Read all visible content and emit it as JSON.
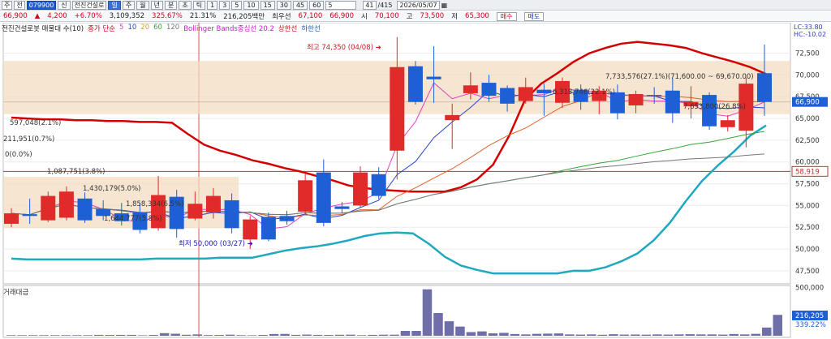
{
  "toolbar": {
    "market": "주",
    "side": "전",
    "code": "079900",
    "name_tag": "신",
    "stock_name": "전진건설로",
    "periods": [
      "일",
      "주",
      "월",
      "년",
      "분",
      "초",
      "틱"
    ],
    "selected_period": "일",
    "intervals": [
      "1",
      "3",
      "5",
      "10",
      "15",
      "30",
      "45",
      "60"
    ],
    "interval_value": "5",
    "page": "41",
    "total": "/415",
    "date": "2026/05/07",
    "calendar_icon": "calendar-icon"
  },
  "quote": {
    "price": "66,900",
    "arrow": "▲",
    "change": "4,200",
    "pct": "+6.70%",
    "volume": "3,109,352",
    "vol_ratio": "325.67%",
    "turnover": "21.31%",
    "amount": "216,205백만",
    "best_label": "최우선",
    "best": "67,100",
    "best2": "66,900",
    "open_label": "시",
    "open": "70,100",
    "high_label": "고",
    "high": "73,500",
    "low_label": "저",
    "low": "65,300",
    "buy_label": "매수",
    "sell_label": "매도"
  },
  "legend": {
    "title": "전진건설로봇 매물대 수(10)",
    "ma_label": "종가 단순",
    "ma_periods": [
      "5",
      "10",
      "20",
      "60",
      "120"
    ],
    "bb_label": "Bollinger Bands중심선 20.2",
    "upper_label": "상한선",
    "lower_label": "하한선"
  },
  "colors": {
    "up": "#e12a2a",
    "down": "#1f5fd6",
    "bb_mid": "#d40000",
    "bb_lower": "#1fa8bf",
    "ma5": "#e040c0",
    "ma10": "#2a44c8",
    "ma20": "#e0602a",
    "ma60": "#3aa33a",
    "ma120": "#777777",
    "volume": "#6e6ea8",
    "profile": "#f3dcc0"
  },
  "annotations": {
    "high_note": "최고 74,350 (04/08)",
    "low_note": "최저 50,000 (03/27)",
    "lc": "LC:33.80",
    "hc": "HC:-10.02"
  },
  "chart_data": {
    "type": "candlestick",
    "ylim": [
      46000,
      76000
    ],
    "yticks": [
      "72,500",
      "70,000",
      "67,500",
      "65,000",
      "62,500",
      "60,000",
      "57,500",
      "55,000",
      "52,500",
      "50,000",
      "47,500"
    ],
    "ytick_values": [
      72500,
      70000,
      67500,
      65000,
      62500,
      60000,
      57500,
      55000,
      52500,
      50000,
      47500
    ],
    "price_marker": "66,900",
    "price_marker_value": 66900,
    "line_marker": "58,919",
    "line_marker_value": 58919,
    "candles": [
      {
        "o": 52900,
        "c": 54100,
        "h": 54700,
        "l": 52500
      },
      {
        "o": 54000,
        "c": 53800,
        "h": 55800,
        "l": 52900
      },
      {
        "o": 53300,
        "c": 56100,
        "h": 56600,
        "l": 53100
      },
      {
        "o": 53600,
        "c": 56600,
        "h": 57200,
        "l": 53300
      },
      {
        "o": 55800,
        "c": 53300,
        "h": 56500,
        "l": 53000
      },
      {
        "o": 54600,
        "c": 53800,
        "h": 55600,
        "l": 53300
      },
      {
        "o": 54100,
        "c": 53200,
        "h": 55300,
        "l": 52700
      },
      {
        "o": 54200,
        "c": 52200,
        "h": 55300,
        "l": 51800
      },
      {
        "o": 52400,
        "c": 56200,
        "h": 58400,
        "l": 52100
      },
      {
        "o": 56000,
        "c": 52300,
        "h": 56800,
        "l": 51300
      },
      {
        "o": 53500,
        "c": 55200,
        "h": 56600,
        "l": 53300
      },
      {
        "o": 54200,
        "c": 56100,
        "h": 57000,
        "l": 53500
      },
      {
        "o": 55600,
        "c": 52400,
        "h": 56400,
        "l": 51800
      },
      {
        "o": 51100,
        "c": 53400,
        "h": 53800,
        "l": 50000
      },
      {
        "o": 53700,
        "c": 51100,
        "h": 54200,
        "l": 50900
      },
      {
        "o": 53800,
        "c": 53200,
        "h": 54400,
        "l": 52800
      },
      {
        "o": 54300,
        "c": 57900,
        "h": 58600,
        "l": 54100
      },
      {
        "o": 58800,
        "c": 53000,
        "h": 60300,
        "l": 52600
      },
      {
        "o": 54900,
        "c": 54600,
        "h": 55400,
        "l": 54100
      },
      {
        "o": 55000,
        "c": 58800,
        "h": 59500,
        "l": 54800
      },
      {
        "o": 58600,
        "c": 56100,
        "h": 59400,
        "l": 55700
      },
      {
        "o": 61300,
        "c": 70900,
        "h": 74350,
        "l": 58000
      },
      {
        "o": 71000,
        "c": 66900,
        "h": 71600,
        "l": 66600
      },
      {
        "o": 69800,
        "c": 69500,
        "h": 73300,
        "l": 66800
      },
      {
        "o": 64800,
        "c": 65400,
        "h": 66700,
        "l": 61500
      },
      {
        "o": 67900,
        "c": 68800,
        "h": 70300,
        "l": 67200
      },
      {
        "o": 69100,
        "c": 67600,
        "h": 70000,
        "l": 66900
      },
      {
        "o": 68500,
        "c": 66700,
        "h": 68800,
        "l": 65800
      },
      {
        "o": 67000,
        "c": 68600,
        "h": 69700,
        "l": 66700
      },
      {
        "o": 68300,
        "c": 67900,
        "h": 69000,
        "l": 65300
      },
      {
        "o": 66800,
        "c": 69300,
        "h": 69700,
        "l": 66200
      },
      {
        "o": 68300,
        "c": 66900,
        "h": 68900,
        "l": 66000
      },
      {
        "o": 67000,
        "c": 68200,
        "h": 68700,
        "l": 65500
      },
      {
        "o": 68000,
        "c": 65600,
        "h": 68900,
        "l": 64900
      },
      {
        "o": 66500,
        "c": 67800,
        "h": 68200,
        "l": 65600
      },
      {
        "o": 67700,
        "c": 67600,
        "h": 68600,
        "l": 66700
      },
      {
        "o": 68200,
        "c": 65600,
        "h": 69600,
        "l": 64500
      },
      {
        "o": 66400,
        "c": 66900,
        "h": 68700,
        "l": 65000
      },
      {
        "o": 67700,
        "c": 64100,
        "h": 68000,
        "l": 63700
      },
      {
        "o": 64000,
        "c": 64800,
        "h": 65400,
        "l": 63500
      },
      {
        "o": 63600,
        "c": 69000,
        "h": 69700,
        "l": 61700
      },
      {
        "o": 70200,
        "c": 66900,
        "h": 73500,
        "l": 65300
      }
    ],
    "series": [
      {
        "name": "중심선",
        "values": [
          65100,
          65000,
          64900,
          64900,
          64800,
          64800,
          64700,
          64700,
          64600,
          64600,
          64500,
          63200,
          62000,
          61300,
          60800,
          60200,
          59800,
          59300,
          58900,
          58400,
          57900,
          57300,
          57000,
          56800,
          56700,
          56600,
          56600,
          56600,
          57100,
          58000,
          59700,
          63000,
          67200,
          69000,
          70200,
          71500,
          72500,
          73100,
          73600,
          73800,
          73600,
          73400,
          73100,
          72500,
          72000,
          71500,
          70900,
          70100
        ]
      },
      {
        "name": "하한선",
        "values": [
          48900,
          48800,
          48800,
          48800,
          48800,
          48800,
          48800,
          48800,
          48800,
          48900,
          48900,
          48900,
          48900,
          49000,
          49000,
          49000,
          49400,
          49800,
          50100,
          50300,
          50600,
          51000,
          51500,
          51800,
          51900,
          51800,
          50600,
          49100,
          48100,
          47600,
          47200,
          47200,
          47200,
          47200,
          47200,
          47500,
          47500,
          47900,
          48600,
          49500,
          51000,
          53000,
          55500,
          57800,
          59600,
          61200,
          63000,
          64200
        ]
      }
    ],
    "overlay_labels": [
      {
        "text": "597,048(2.1%)"
      },
      {
        "text": "211,951(0.7%)"
      },
      {
        "text": "0(0.0%)"
      },
      {
        "text": "1,087,751(3.8%)"
      },
      {
        "text": "1,430,179(5.0%)"
      },
      {
        "text": "1,858,334(6.5%)"
      },
      {
        "text": "1,644,777(5.8%)"
      },
      {
        "text": "7,733,576(27.1%)(71,600.00 ~ 69,670.00)"
      },
      {
        "text": "6,318,746(22.1%)"
      },
      {
        "text": "7,653,800(26.8%)"
      }
    ]
  },
  "volume": {
    "title": "거래대금",
    "yticks": [
      "500,000"
    ],
    "ytick_values": [
      500000
    ],
    "ylim": [
      0,
      520000
    ],
    "marker": "216,205",
    "marker2": "339.22%",
    "values": [
      6000,
      6000,
      6000,
      6000,
      6000,
      6000,
      6000,
      6000,
      9000,
      8000,
      9000,
      9000,
      5000,
      8000,
      27000,
      21000,
      10000,
      14000,
      7000,
      8000,
      11000,
      6000,
      5000,
      8000,
      18000,
      19000,
      9000,
      12000,
      9000,
      8000,
      10000,
      11000,
      6000,
      9000,
      11000,
      11000,
      50000,
      50000,
      480000,
      235000,
      150000,
      95000,
      38000,
      45000,
      25000,
      30000,
      18000,
      14000,
      20000,
      22000,
      24000,
      14000,
      12000,
      14000,
      10000,
      16000,
      12000,
      13000,
      11000,
      14000,
      12000,
      14000,
      16000,
      14000,
      14000,
      12000,
      18000,
      14000,
      20000,
      85000,
      216000
    ]
  }
}
